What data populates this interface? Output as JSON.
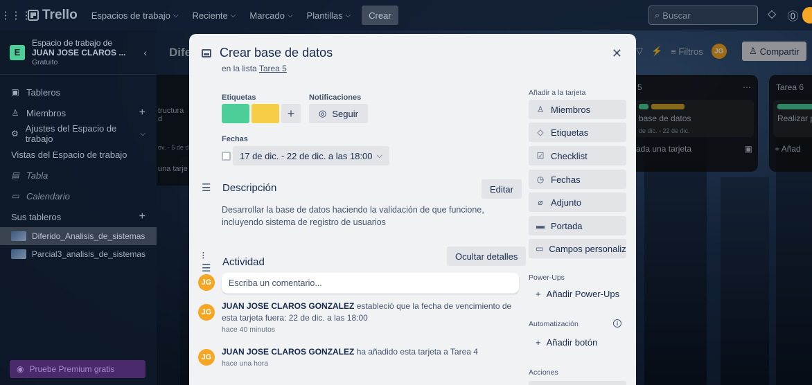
{
  "header": {
    "logo": "Trello",
    "nav": [
      {
        "label": "Espacios de trabajo"
      },
      {
        "label": "Reciente"
      },
      {
        "label": "Marcado"
      },
      {
        "label": "Plantillas"
      }
    ],
    "create_label": "Crear",
    "search_placeholder": "Buscar"
  },
  "sidebar": {
    "workspace_letter": "E",
    "workspace_name_line1": "Espacio de trabajo de",
    "workspace_name_line2": "JUAN JOSE CLAROS ...",
    "workspace_plan": "Gratuito",
    "items": [
      {
        "label": "Tableros"
      },
      {
        "label": "Miembros"
      },
      {
        "label": "Ajustes del Espacio de trabajo"
      }
    ],
    "views_heading": "Vistas del Espacio de trabajo",
    "views": [
      {
        "label": "Tabla"
      },
      {
        "label": "Calendario"
      }
    ],
    "boards_heading": "Sus tableros",
    "boards": [
      {
        "label": "Diferido_Analisis_de_sistemas"
      },
      {
        "label": "Parcial3_analisis_de_sistemas"
      }
    ],
    "premium_label": "Pruebe Premium gratis"
  },
  "board": {
    "title_partial": "Dife",
    "filters_label": "Filtros",
    "avatar_initials": "JG",
    "share_label": "Compartir",
    "left_col_text1": "tructura d",
    "left_col_text2": "ov. - 5 de d",
    "left_col_text3": "una tarje",
    "list5_title": "5",
    "list5_card": "base de datos",
    "list5_card_date": "de dic. - 22 de dic.",
    "list5_add": "ada una tarjeta",
    "list6_title": "Tarea 6",
    "list6_card": "Realizar p",
    "list6_add": "Añad"
  },
  "modal": {
    "title": "Crear base de datos",
    "in_list_prefix": "en la lista",
    "list_name": "Tarea 5",
    "labels_heading": "Etiquetas",
    "notifications_heading": "Notificaciones",
    "follow_label": "Seguir",
    "dates_heading": "Fechas",
    "date_value": "17 de dic. - 22 de dic. a las 18:00",
    "description_heading": "Descripción",
    "edit_label": "Editar",
    "description_text": "Desarrollar la base de datos haciendo la validación de que funcione, incluyendo sistema de registro de usuarios",
    "activity_heading": "Actividad",
    "hide_details_label": "Ocultar detalles",
    "comment_placeholder": "Escriba un comentario...",
    "avatar_initials": "JG",
    "activity": [
      {
        "user": "JUAN JOSE CLAROS GONZALEZ",
        "text": " estableció que la fecha de vencimiento de esta tarjeta fuera: 22 de dic. a las 18:00",
        "time": "hace 40 minutos"
      },
      {
        "user": "JUAN JOSE CLAROS GONZALEZ",
        "text": " ha añadido esta tarjeta a Tarea 4",
        "time": "hace una hora"
      }
    ],
    "add_to_card_heading": "Añadir a la tarjeta",
    "add_to_card": [
      {
        "label": "Miembros"
      },
      {
        "label": "Etiquetas"
      },
      {
        "label": "Checklist"
      },
      {
        "label": "Fechas"
      },
      {
        "label": "Adjunto"
      },
      {
        "label": "Portada"
      },
      {
        "label": "Campos personaliz..."
      }
    ],
    "powerups_heading": "Power-Ups",
    "add_powerups_label": "Añadir Power-Ups",
    "automation_heading": "Automatización",
    "add_button_label": "Añadir botón",
    "actions_heading": "Acciones"
  },
  "colors": {
    "label_green": "#4bce97",
    "label_yellow": "#f5cd47",
    "avatar": "#f5a623"
  }
}
